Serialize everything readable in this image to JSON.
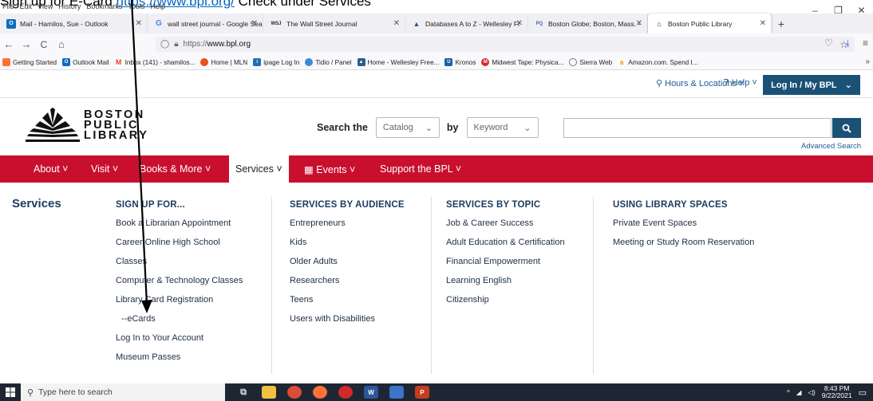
{
  "caption": {
    "text_before": "Sign up for E-Card",
    "link": "https://www.bpl.org/",
    "text_after": "Check under Services"
  },
  "menubar": [
    "File",
    "Edit",
    "View",
    "History",
    "Bookmarks",
    "Tools",
    "Help"
  ],
  "tabs": [
    {
      "label": "Mail - Hamilos, Sue - Outlook",
      "icon": "outlook-icon",
      "color": "#0f6cbd",
      "glyph": "O"
    },
    {
      "label": "wall street journal - Google Sea",
      "icon": "google-icon",
      "color": "#4285f4",
      "glyph": "G"
    },
    {
      "label": "The Wall Street Journal",
      "icon": "wsj-icon",
      "color": "#ffffff",
      "glyph": "WSJ"
    },
    {
      "label": "Databases A to Z - Wellesley Fr",
      "icon": "wellesley-icon",
      "color": "#2b5d8c",
      "glyph": "▲"
    },
    {
      "label": "Boston Globe; Boston, Mass. -",
      "icon": "proquest-icon",
      "color": "#ffffff",
      "glyph": "PQ"
    },
    {
      "label": "Boston Public Library",
      "icon": "bpl-icon",
      "color": "#ffffff",
      "glyph": "∩",
      "active": true
    }
  ],
  "nav": {
    "back": "←",
    "forward": "→",
    "reload": "C",
    "home": "⌂",
    "url_prefix": "https://",
    "url_host": "www.bpl.org"
  },
  "bookmarks": [
    {
      "label": "Getting Started",
      "color": "#ff7139"
    },
    {
      "label": "Outlook Mail",
      "color": "#0f6cbd"
    },
    {
      "label": "Inbox (141) - shamilos...",
      "color": "#ea4335"
    },
    {
      "label": "Home | MLN",
      "color": "#e8521a"
    },
    {
      "label": "ipage Log In",
      "color": "#1e6fb8"
    },
    {
      "label": "Tidio / Panel",
      "color": "#3a8bd6"
    },
    {
      "label": "Home - Wellesley Free...",
      "color": "#2b5d8c"
    },
    {
      "label": "Kronos",
      "color": "#1d5fa8"
    },
    {
      "label": "Midwest Tape: Physica...",
      "color": "#d22a2a"
    },
    {
      "label": "Sierra Web",
      "color": "#555555"
    },
    {
      "label": "Amazon.com. Spend I...",
      "color": "#ff9900"
    }
  ],
  "utility": {
    "hours": "Hours & Locations ˅",
    "help": "Help ˅",
    "login": "Log In / My BPL"
  },
  "logo": {
    "line1": "BOSTON",
    "line2": "PUBLIC",
    "line3": "LIBRARY"
  },
  "search": {
    "label_search": "Search the",
    "catalog": "Catalog",
    "by": "by",
    "keyword": "Keyword",
    "advanced": "Advanced Search"
  },
  "mainnav": {
    "about": "About ˅",
    "visit": "Visit ˅",
    "books": "Books & More ˅",
    "services": "Services ˅",
    "events": "Events ˅",
    "support": "Support the BPL ˅"
  },
  "services_title": "Services",
  "columns": [
    {
      "heading": "SIGN UP FOR...",
      "items": [
        "Book a Librarian Appointment",
        "Career Online High School",
        "Classes",
        "Computer & Technology Classes",
        "Library Card Registration",
        "--eCards",
        "Log In to Your Account",
        "Museum Passes"
      ]
    },
    {
      "heading": "SERVICES BY AUDIENCE",
      "items": [
        "Entrepreneurs",
        "Kids",
        "Older Adults",
        "Researchers",
        "Teens",
        "Users with Disabilities"
      ]
    },
    {
      "heading": "SERVICES BY TOPIC",
      "items": [
        "Job & Career Success",
        "Adult Education & Certification",
        "Financial Empowerment",
        "Learning English",
        "Citizenship"
      ]
    },
    {
      "heading": "USING LIBRARY SPACES",
      "items": [
        "Private Event Spaces",
        "Meeting or Study Room Reservation"
      ]
    }
  ],
  "taskbar": {
    "search_placeholder": "Type here to search",
    "time": "8:43 PM",
    "date": "9/22/2021"
  },
  "colors": {
    "bpl_red": "#c8102e",
    "bpl_navy": "#1a5276",
    "heading_navy": "#1c3c60"
  }
}
